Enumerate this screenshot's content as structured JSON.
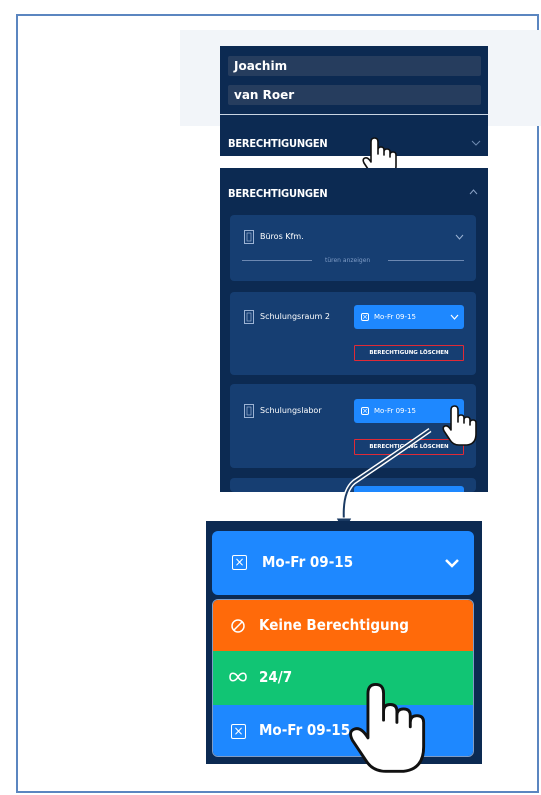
{
  "user": {
    "first_name": "Joachim",
    "last_name": "van Roer"
  },
  "permissions_title": "BERECHTIGUNGEN",
  "card_buero": {
    "name": "Büros Kfm.",
    "show_doors": "türen anzeigen"
  },
  "card_schulungsraum": {
    "name": "Schulungsraum 2",
    "schedule": "Mo-Fr 09-15",
    "delete_label": "BERECHTIGUNG LÖSCHEN"
  },
  "card_schulungslabor": {
    "name": "Schulungslabor",
    "schedule": "Mo-Fr 09-15",
    "delete_label": "BERECHTIGUNG LÖSCHEN"
  },
  "dropdown": {
    "selected": "Mo-Fr 09-15",
    "options": [
      {
        "label": "Keine Berechtigung",
        "color": "#ff6a0a",
        "icon": "forbidden-icon"
      },
      {
        "label": "24/7",
        "color": "#11c574",
        "icon": "infinity-icon"
      },
      {
        "label": "Mo-Fr 09-15",
        "color": "#1e88ff",
        "icon": "x-box-icon"
      }
    ]
  },
  "colors": {
    "panel": "#0c2a52",
    "card": "#163e72",
    "accent": "#1e88ff",
    "danger": "#e02a36"
  }
}
